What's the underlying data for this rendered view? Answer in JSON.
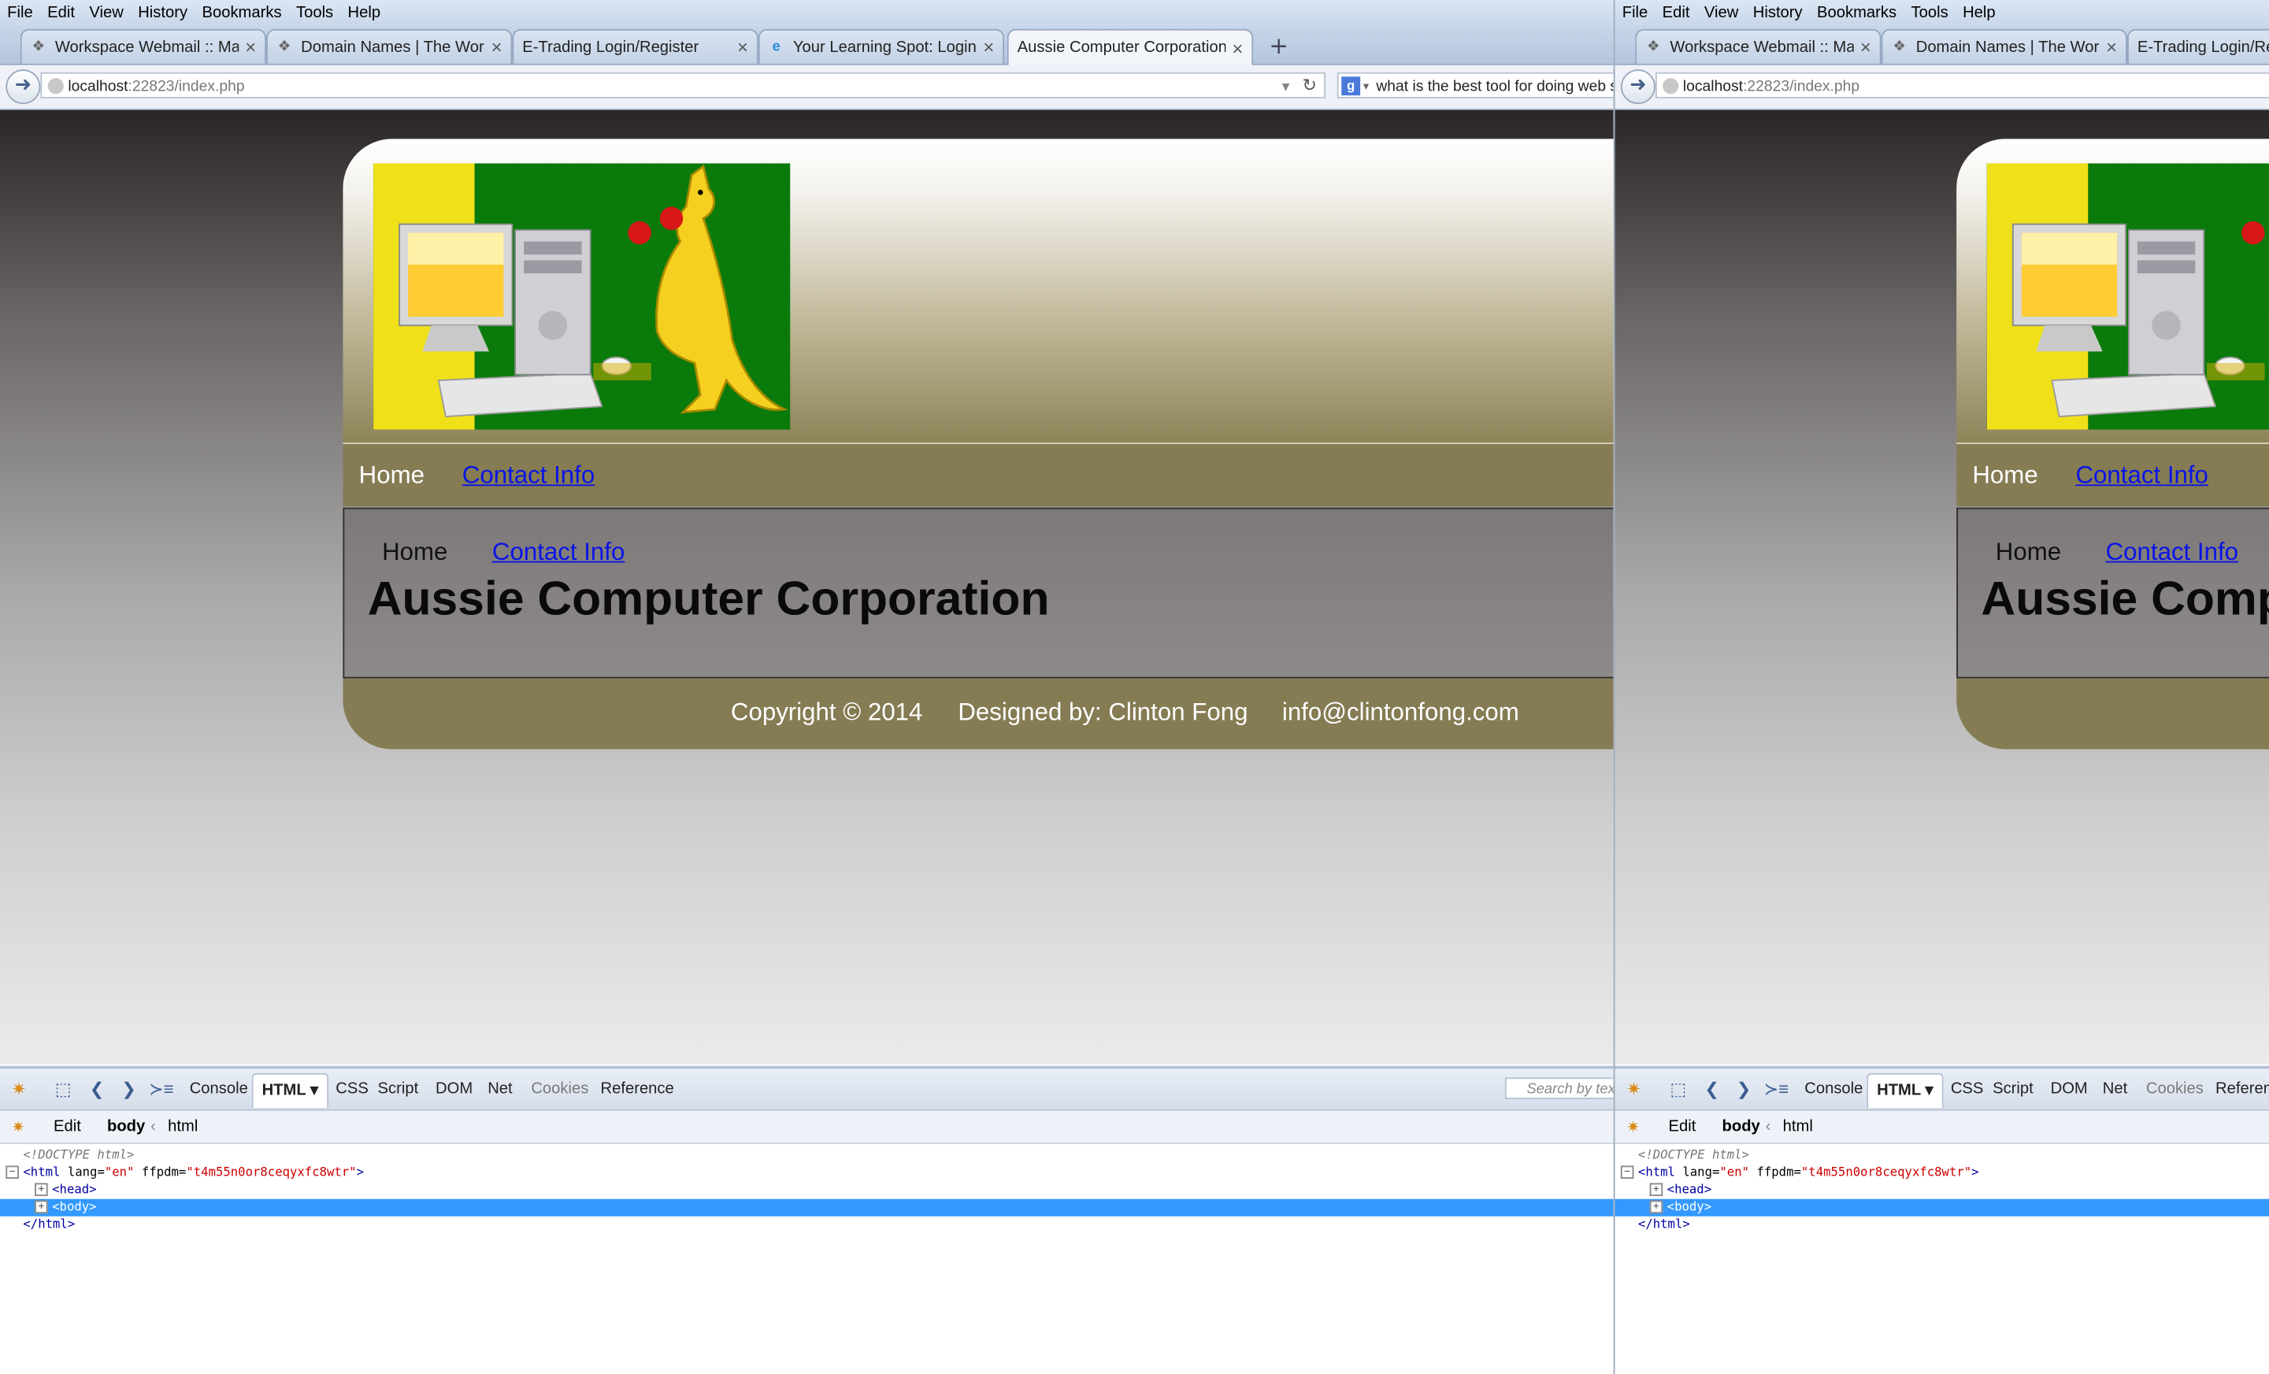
{
  "browser": {
    "menu": [
      "File",
      "Edit",
      "View",
      "History",
      "Bookmarks",
      "Tools",
      "Help"
    ],
    "tabs": [
      {
        "label": "Workspace Webmail :: Mail...",
        "active": false
      },
      {
        "label": "Domain Names | The Worl...",
        "active": false
      },
      {
        "label": "E-Trading Login/Register",
        "active": false
      },
      {
        "label": "Your Learning Spot: Login ...",
        "active": false
      },
      {
        "label": "Aussie Computer Corporation",
        "active": true
      }
    ],
    "new_tab": "+",
    "url_host": "localhost",
    "url_rest": ":22823/index.php",
    "search_text": "what is the best tool for doing web sc"
  },
  "site": {
    "topnav": {
      "home": "Home",
      "contact": "Contact Info"
    },
    "content_nav": {
      "home": "Home",
      "contact": "Contact Info"
    },
    "heading": "Aussie Computer Corporation",
    "footer": {
      "copyright": "Copyright © 2014",
      "designer": "Designed by: Clinton Fong",
      "email": "info@clintonfong.com"
    },
    "colors": {
      "nav_bg": "#857c54",
      "link": "#0a14e6",
      "logo_green": "#0a7a0a",
      "logo_yellow": "#f0e01a"
    }
  },
  "devtools": {
    "tabs": [
      "Console",
      "HTML",
      "CSS",
      "Script",
      "DOM",
      "Net",
      "Cookies",
      "Reference"
    ],
    "active_tab": "HTML",
    "search_placeholder": "Search by text",
    "edit_label": "Edit",
    "crumb_body": "body",
    "crumb_html": "html",
    "code": {
      "doctype": "<!DOCTYPE html>",
      "html_open_tag": "<html",
      "lang_attr": "lang=",
      "lang_val": "\"en\"",
      "ff_attr": "ffpdm=",
      "ff_val": "\"t4m55n0or8ceqyxfc8wtr\"",
      "html_open_end": ">",
      "head": "<head>",
      "body": "<body>",
      "html_close": "</html>"
    }
  }
}
